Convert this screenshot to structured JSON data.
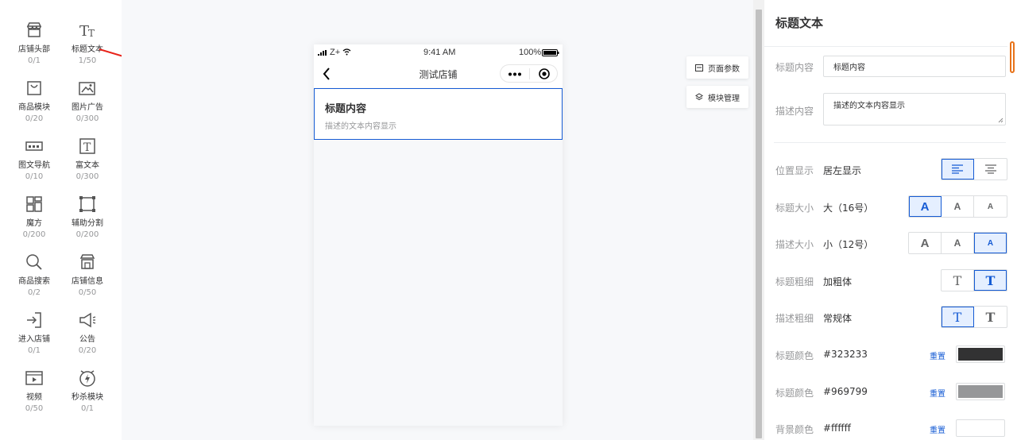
{
  "palette": [
    {
      "name": "店铺头部",
      "count": "0/1",
      "icon": "storefront-icon"
    },
    {
      "name": "标题文本",
      "count": "1/50",
      "icon": "title-text-icon"
    },
    {
      "name": "商品模块",
      "count": "0/20",
      "icon": "shopping-bag-icon"
    },
    {
      "name": "图片广告",
      "count": "0/300",
      "icon": "image-ad-icon"
    },
    {
      "name": "图文导航",
      "count": "0/10",
      "icon": "image-nav-icon"
    },
    {
      "name": "富文本",
      "count": "0/300",
      "icon": "rich-text-icon"
    },
    {
      "name": "魔方",
      "count": "0/200",
      "icon": "cube-grid-icon"
    },
    {
      "name": "辅助分割",
      "count": "0/200",
      "icon": "divider-icon"
    },
    {
      "name": "商品搜索",
      "count": "0/2",
      "icon": "search-icon"
    },
    {
      "name": "店铺信息",
      "count": "0/50",
      "icon": "store-info-icon"
    },
    {
      "name": "进入店铺",
      "count": "0/1",
      "icon": "enter-store-icon"
    },
    {
      "name": "公告",
      "count": "0/20",
      "icon": "megaphone-icon"
    },
    {
      "name": "视频",
      "count": "0/50",
      "icon": "video-icon"
    },
    {
      "name": "秒杀模块",
      "count": "0/1",
      "icon": "flash-sale-icon"
    }
  ],
  "phone": {
    "carrier": "Z+",
    "time": "9:41 AM",
    "battery": "100%",
    "page_title": "测试店铺",
    "block_title": "标题内容",
    "block_desc": "描述的文本内容显示"
  },
  "side_buttons": {
    "page_params": "页面参数",
    "module_manage": "模块管理"
  },
  "panel": {
    "title": "标题文本",
    "title_content_label": "标题内容",
    "title_content_value": "标题内容",
    "desc_content_label": "描述内容",
    "desc_content_value": "描述的文本内容显示",
    "position_label": "位置显示",
    "position_value": "居左显示",
    "title_size_label": "标题大小",
    "title_size_value": "大（16号）",
    "desc_size_label": "描述大小",
    "desc_size_value": "小（12号）",
    "title_weight_label": "标题粗细",
    "title_weight_value": "加粗体",
    "desc_weight_label": "描述粗细",
    "desc_weight_value": "常规体",
    "title_color_label": "标题颜色",
    "title_color_value": "#323233",
    "desc_color_label": "标题颜色",
    "desc_color_value": "#969799",
    "bg_color_label": "背景颜色",
    "bg_color_value": "#ffffff",
    "reset": "重置",
    "size_glyph": "A",
    "weight_glyph": "T"
  },
  "colors": {
    "accent": "#155bd4",
    "arrow": "#e8231a",
    "title": "#323233",
    "desc": "#969799",
    "bg": "#ffffff"
  }
}
